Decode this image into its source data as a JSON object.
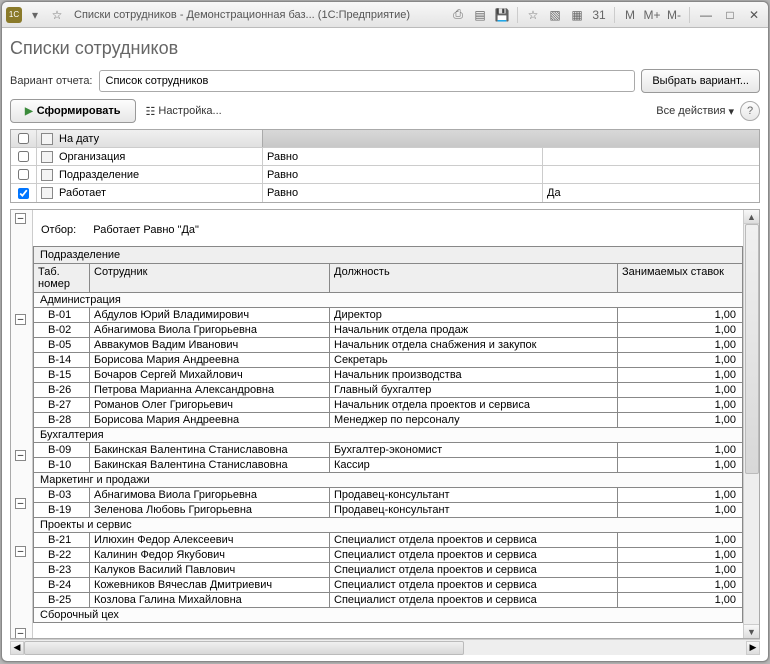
{
  "titlebar": {
    "title": "Списки сотрудников - Демонстрационная баз...  (1С:Предприятие)",
    "mem_labels": {
      "m": "M",
      "mplus": "M+",
      "mminus": "M-"
    }
  },
  "page": {
    "title": "Списки сотрудников"
  },
  "variant": {
    "label": "Вариант отчета:",
    "value": "Список сотрудников",
    "select_btn": "Выбрать вариант..."
  },
  "toolbar": {
    "form_btn": "Сформировать",
    "settings_btn": "Настройка...",
    "all_actions": "Все действия"
  },
  "filters": {
    "header_label": "На дату",
    "rows": [
      {
        "checked": false,
        "name": "Организация",
        "op": "Равно",
        "val": ""
      },
      {
        "checked": false,
        "name": "Подразделение",
        "op": "Равно",
        "val": ""
      },
      {
        "checked": true,
        "name": "Работает",
        "op": "Равно",
        "val": "Да"
      }
    ]
  },
  "report": {
    "otbor_label": "Отбор:",
    "otbor_text": "Работает Равно \"Да\"",
    "top_header": "Подразделение",
    "columns": {
      "tab": "Таб. номер",
      "emp": "Сотрудник",
      "pos": "Должность",
      "rate": "Занимаемых ставок"
    },
    "groups": [
      {
        "name": "Администрация",
        "rows": [
          {
            "tab": "В-01",
            "emp": "Абдулов Юрий Владимирович",
            "pos": "Директор",
            "rate": "1,00"
          },
          {
            "tab": "В-02",
            "emp": "Абнагимова Виола Григорьевна",
            "pos": "Начальник отдела продаж",
            "rate": "1,00"
          },
          {
            "tab": "В-05",
            "emp": "Аввакумов Вадим Иванович",
            "pos": "Начальник отдела снабжения и закупок",
            "rate": "1,00"
          },
          {
            "tab": "В-14",
            "emp": "Борисова Мария Андреевна",
            "pos": "Секретарь",
            "rate": "1,00"
          },
          {
            "tab": "В-15",
            "emp": "Бочаров Сергей Михайлович",
            "pos": "Начальник производства",
            "rate": "1,00"
          },
          {
            "tab": "В-26",
            "emp": "Петрова Марианна Александровна",
            "pos": "Главный бухгалтер",
            "rate": "1,00"
          },
          {
            "tab": "В-27",
            "emp": "Романов Олег Григорьевич",
            "pos": "Начальник отдела проектов и сервиса",
            "rate": "1,00"
          },
          {
            "tab": "В-28",
            "emp": "Борисова Мария Андреевна",
            "pos": "Менеджер по персоналу",
            "rate": "1,00"
          }
        ]
      },
      {
        "name": "Бухгалтерия",
        "rows": [
          {
            "tab": "В-09",
            "emp": "Бакинская Валентина Станиславовна",
            "pos": "Бухгалтер-экономист",
            "rate": "1,00"
          },
          {
            "tab": "В-10",
            "emp": "Бакинская Валентина Станиславовна",
            "pos": "Кассир",
            "rate": "1,00"
          }
        ]
      },
      {
        "name": "Маркетинг и продажи",
        "rows": [
          {
            "tab": "В-03",
            "emp": "Абнагимова Виола Григорьевна",
            "pos": "Продавец-консультант",
            "rate": "1,00"
          },
          {
            "tab": "В-19",
            "emp": "Зеленова Любовь Григорьевна",
            "pos": "Продавец-консультант",
            "rate": "1,00"
          }
        ]
      },
      {
        "name": "Проекты и сервис",
        "rows": [
          {
            "tab": "В-21",
            "emp": "Илюхин Федор Алексеевич",
            "pos": "Специалист отдела проектов и сервиса",
            "rate": "1,00"
          },
          {
            "tab": "В-22",
            "emp": "Калинин Федор Якубович",
            "pos": "Специалист отдела проектов и сервиса",
            "rate": "1,00"
          },
          {
            "tab": "В-23",
            "emp": "Калуков Василий Павлович",
            "pos": "Специалист отдела проектов и сервиса",
            "rate": "1,00"
          },
          {
            "tab": "В-24",
            "emp": "Кожевников Вячеслав Дмитриевич",
            "pos": "Специалист отдела проектов и сервиса",
            "rate": "1,00"
          },
          {
            "tab": "В-25",
            "emp": "Козлова Галина Михайловна",
            "pos": "Специалист отдела проектов и сервиса",
            "rate": "1,00"
          }
        ]
      },
      {
        "name": "Сборочный цех",
        "rows": []
      }
    ]
  }
}
